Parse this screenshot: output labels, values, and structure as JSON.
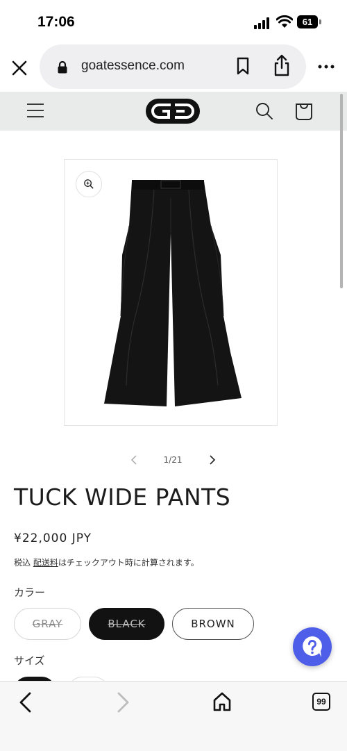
{
  "status_bar": {
    "time": "17:06",
    "battery": "61"
  },
  "browser": {
    "url": "goatessence.com",
    "tab_count": "99"
  },
  "product": {
    "image_counter": "1/21",
    "title": "TUCK WIDE PANTS",
    "price": "¥22,000 JPY",
    "tax_prefix": "税込 ",
    "tax_link": "配送料",
    "tax_suffix": "はチェックアウト時に計算されます。",
    "color_label": "カラー",
    "colors": [
      {
        "label": "GRAY",
        "available": false
      },
      {
        "label": "BLACK",
        "available": false,
        "selected": true
      },
      {
        "label": "BROWN",
        "available": true
      }
    ],
    "size_label": "サイズ"
  },
  "colors": {
    "accent": "#4f5ee9",
    "header_bg": "#e9ebea",
    "text": "#121212"
  }
}
